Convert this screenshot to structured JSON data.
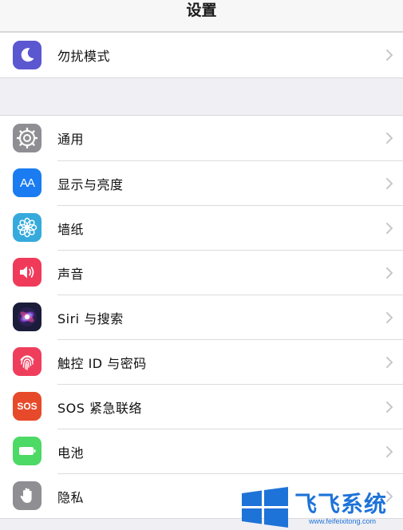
{
  "nav": {
    "title": "设置"
  },
  "groups": [
    {
      "items": [
        {
          "label": "勿扰模式",
          "icon": "moon-icon",
          "color": "#5b57d1"
        }
      ]
    },
    {
      "items": [
        {
          "label": "通用",
          "icon": "gear-icon",
          "color": "#8e8e93"
        },
        {
          "label": "显示与亮度",
          "icon": "text-size-icon",
          "color": "#1a7cf0"
        },
        {
          "label": "墙纸",
          "icon": "flower-icon",
          "color": "#36aadc"
        },
        {
          "label": "声音",
          "icon": "speaker-icon",
          "color": "#f03a5a"
        },
        {
          "label": "Siri 与搜索",
          "icon": "siri-icon",
          "color": "#1b1b3a"
        },
        {
          "label": "触控 ID 与密码",
          "icon": "fingerprint-icon",
          "color": "#ef3e5c"
        },
        {
          "label": "SOS 紧急联络",
          "icon": "sos-icon",
          "color": "#e74a2a"
        },
        {
          "label": "电池",
          "icon": "battery-icon",
          "color": "#4cd964"
        },
        {
          "label": "隐私",
          "icon": "hand-icon",
          "color": "#8e8e93"
        }
      ]
    }
  ],
  "icons": {
    "sos_text": "SOS",
    "aa_text": "AA"
  },
  "watermark": {
    "brand": "飞飞系统",
    "url": "www.feifeixitong.com",
    "color": "#1e73d8"
  }
}
